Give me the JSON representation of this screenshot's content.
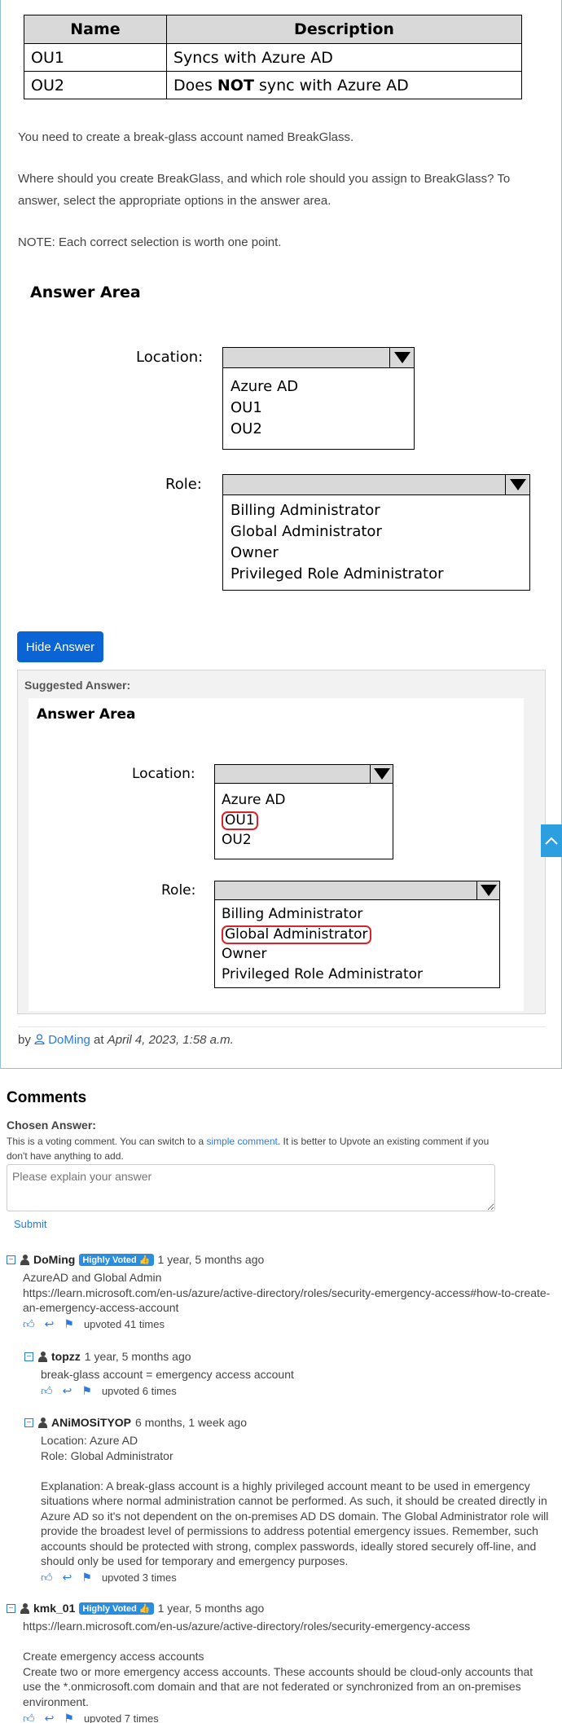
{
  "ou_table": {
    "headers": [
      "Name",
      "Description"
    ],
    "rows": [
      {
        "name": "OU1",
        "desc_pre": "Syncs with Azure AD",
        "desc_bold": "",
        "desc_post": ""
      },
      {
        "name": "OU2",
        "desc_pre": "Does ",
        "desc_bold": "NOT",
        "desc_post": " sync with Azure AD"
      }
    ]
  },
  "question": {
    "p1": "You need to create a break-glass account named BreakGlass.",
    "p2": "Where should you create BreakGlass, and which role should you assign to BreakGlass? To answer, select the appropriate options in the answer area.",
    "p3": "NOTE: Each correct selection is worth one point."
  },
  "answer_area": {
    "title": "Answer Area",
    "location_label": "Location:",
    "location_options": [
      "Azure AD",
      "OU1",
      "OU2"
    ],
    "role_label": "Role:",
    "role_options": [
      "Billing Administrator",
      "Global Administrator",
      "Owner",
      "Privileged Role Administrator"
    ]
  },
  "hide_answer_label": "Hide Answer",
  "suggested": {
    "title": "Suggested Answer:",
    "selected_location": "OU1",
    "selected_role": "Global Administrator",
    "highlight_color": "#d9232b"
  },
  "byline": {
    "by": "by",
    "user": "DoMing",
    "at": "at",
    "date": "April 4, 2023, 1:58 a.m."
  },
  "comments_section": {
    "title": "Comments",
    "chosen_answer": "Chosen Answer:",
    "hint_pre": "This is a voting comment. You can switch to a ",
    "hint_link": "simple comment",
    "hint_post": ". It is better to Upvote an existing comment if you don't have anything to add.",
    "placeholder": "Please explain your answer",
    "submit": "Submit"
  },
  "comments": [
    {
      "user": "DoMing",
      "badge": "Highly Voted",
      "ago": "1 year, 5 months ago",
      "lines": [
        "AzureAD and Global Admin",
        "https://learn.microsoft.com/en-us/azure/active-directory/roles/security-emergency-access#how-to-create-an-emergency-access-account"
      ],
      "votes": "upvoted 41 times"
    },
    {
      "user": "topzz",
      "badge": "",
      "ago": "1 year, 5 months ago",
      "lines": [
        "break-glass account = emergency access account"
      ],
      "votes": "upvoted 6 times"
    },
    {
      "user": "ANiMOSiTYOP",
      "badge": "",
      "ago": "6 months, 1 week ago",
      "lines": [
        "Location: Azure AD",
        "Role: Global Administrator",
        "",
        "Explanation: A break-glass account is a highly privileged account meant to be used in emergency situations where normal administration cannot be performed. As such, it should be created directly in Azure AD so it's not dependent on the on-premises AD DS domain. The Global Administrator role will provide the broadest level of permissions to address potential emergency issues. Remember, such accounts should be protected with strong, complex passwords, ideally stored securely off-line, and should only be used for temporary and emergency purposes."
      ],
      "votes": "upvoted 3 times"
    },
    {
      "user": "kmk_01",
      "badge": "Highly Voted",
      "ago": "1 year, 5 months ago",
      "lines": [
        "https://learn.microsoft.com/en-us/azure/active-directory/roles/security-emergency-access",
        "",
        "Create emergency access accounts",
        "Create two or more emergency access accounts. These accounts should be cloud-only accounts that use the *.onmicrosoft.com domain and that are not federated or synchronized from an on-premises environment."
      ],
      "votes": "upvoted 7 times"
    }
  ]
}
